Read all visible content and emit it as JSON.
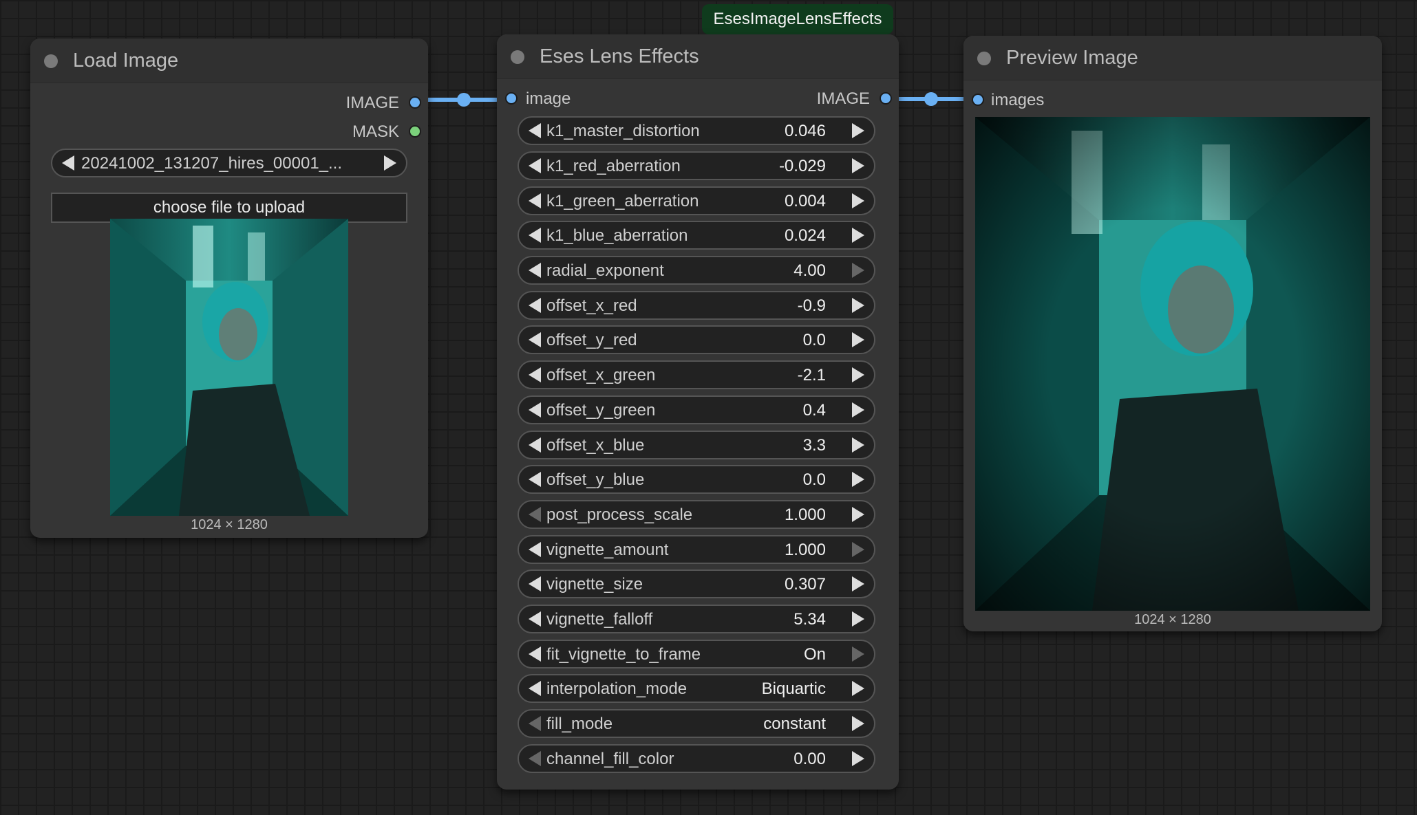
{
  "group_badge": "EsesImageLensEffects",
  "load_image": {
    "title": "Load Image",
    "outputs": [
      "IMAGE",
      "MASK"
    ],
    "file_value": "20241002_131207_hires_00001_...",
    "upload_label": "choose file to upload",
    "image_dims": "1024 × 1280"
  },
  "lens_effects": {
    "title": "Eses Lens Effects",
    "input_label": "image",
    "output_label": "IMAGE",
    "widgets": [
      {
        "name": "k1_master_distortion",
        "value": "0.046"
      },
      {
        "name": "k1_red_aberration",
        "value": "-0.029"
      },
      {
        "name": "k1_green_aberration",
        "value": "0.004"
      },
      {
        "name": "k1_blue_aberration",
        "value": "0.024"
      },
      {
        "name": "radial_exponent",
        "value": "4.00"
      },
      {
        "name": "offset_x_red",
        "value": "-0.9"
      },
      {
        "name": "offset_y_red",
        "value": "0.0"
      },
      {
        "name": "offset_x_green",
        "value": "-2.1"
      },
      {
        "name": "offset_y_green",
        "value": "0.4"
      },
      {
        "name": "offset_x_blue",
        "value": "3.3"
      },
      {
        "name": "offset_y_blue",
        "value": "0.0"
      },
      {
        "name": "post_process_scale",
        "value": "1.000"
      },
      {
        "name": "vignette_amount",
        "value": "1.000"
      },
      {
        "name": "vignette_size",
        "value": "0.307"
      },
      {
        "name": "vignette_falloff",
        "value": "5.34"
      },
      {
        "name": "fit_vignette_to_frame",
        "value": "On"
      },
      {
        "name": "interpolation_mode",
        "value": "Biquartic"
      },
      {
        "name": "fill_mode",
        "value": "constant"
      },
      {
        "name": "channel_fill_color",
        "value": "0.00"
      }
    ]
  },
  "preview_image": {
    "title": "Preview Image",
    "input_label": "images",
    "image_dims": "1024 × 1280"
  },
  "colors": {
    "canvas": "#222222",
    "node_body": "#353535",
    "image_slot": "#6ab0f3",
    "mask_slot": "#7bd17b",
    "badge": "#0f3b1d"
  }
}
